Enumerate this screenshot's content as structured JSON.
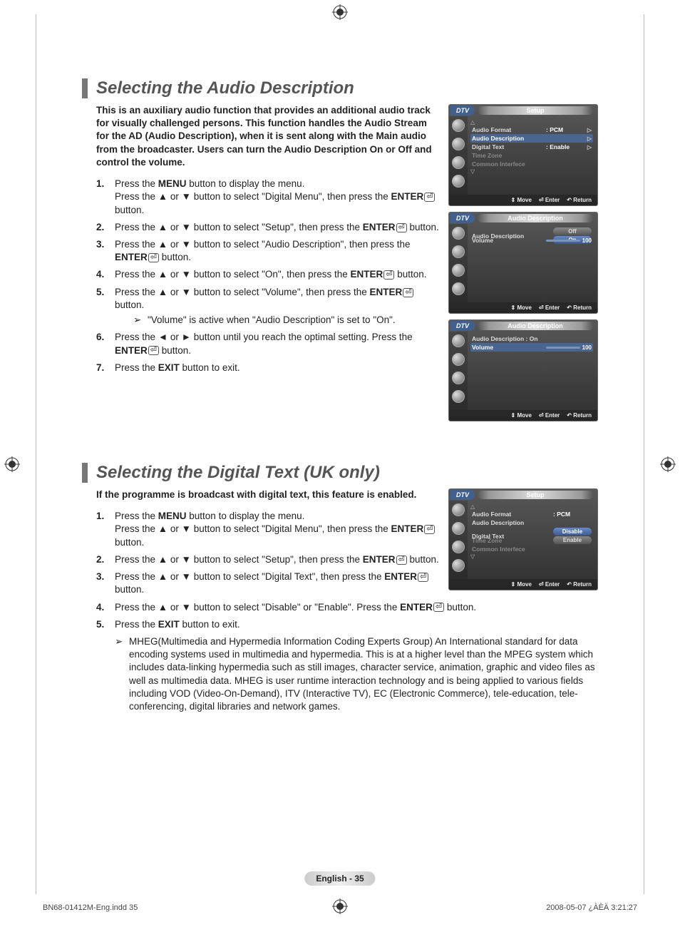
{
  "section1": {
    "title": "Selecting the Audio Description",
    "intro": "This is an auxiliary audio function that provides an additional audio track for visually challenged persons. This function handles the Audio Stream for the AD (Audio Description), when it is sent along with the Main audio from the broadcaster. Users can turn the Audio Description On or Off and control the volume.",
    "steps": [
      {
        "n": "1.",
        "text": "Press the <b>MENU</b> button to display the menu.<br>Press the ▲ or ▼ button to select \"Digital Menu\", then press the <b>ENTER</b><span class='enter-icon'>⏎</span> button."
      },
      {
        "n": "2.",
        "text": "Press the ▲ or ▼ button to select \"Setup\", then press the <b>ENTER</b><span class='enter-icon'>⏎</span> button."
      },
      {
        "n": "3.",
        "text": "Press the ▲ or ▼ button to select \"Audio Description\", then press the <b>ENTER</b><span class='enter-icon'>⏎</span> button."
      },
      {
        "n": "4.",
        "text": "Press the ▲ or ▼ button to select \"On\", then press the <b>ENTER</b><span class='enter-icon'>⏎</span> button."
      },
      {
        "n": "5.",
        "text": "Press the ▲ or ▼ button to select \"Volume\", then press the <b>ENTER</b><span class='enter-icon'>⏎</span> button."
      },
      {
        "n": "6.",
        "text": "Press the ◄ or ► button until you reach the optimal setting. Press the <b>ENTER</b><span class='enter-icon'>⏎</span> button."
      },
      {
        "n": "7.",
        "text": "Press the <b>EXIT</b> button to exit."
      }
    ],
    "note_after_5": "\"Volume\" is active when \"Audio Description\" is set to \"On\"."
  },
  "section2": {
    "title": "Selecting the Digital Text (UK only)",
    "intro": "If the programme is broadcast with digital text, this feature is enabled.",
    "steps": [
      {
        "n": "1.",
        "text": "Press the <b>MENU</b> button to display the menu.<br>Press the ▲ or ▼ button to select \"Digital Menu\", then press the <b>ENTER</b><span class='enter-icon'>⏎</span> button."
      },
      {
        "n": "2.",
        "text": "Press the ▲ or ▼ button to select \"Setup\", then press the <b>ENTER</b><span class='enter-icon'>⏎</span> button."
      },
      {
        "n": "3.",
        "text": "Press the ▲ or ▼ button to select \"Digital Text\", then press the <b>ENTER</b><span class='enter-icon'>⏎</span> button."
      },
      {
        "n": "4.",
        "text": "Press the ▲ or ▼ button to select \"Disable\" or \"Enable\". Press the <b>ENTER</b><span class='enter-icon'>⏎</span> button."
      },
      {
        "n": "5.",
        "text": "Press the <b>EXIT</b> button to exit."
      }
    ],
    "note_after_5": "MHEG(Multimedia and Hypermedia Information Coding Experts Group) An International standard for data encoding systems used in multimedia and hypermedia. This is at a higher level than the MPEG system which includes data-linking hypermedia such as still images, character service, animation, graphic and video files as well as multimedia data. MHEG is user runtime interaction technology and is being applied to various fields including VOD (Video-On-Demand), ITV (Interactive TV), EC (Electronic Commerce), tele-education, tele-conferencing, digital libraries and network games."
  },
  "osd": {
    "dtv": "DTV",
    "setup": "Setup",
    "audio_desc": "Audio Description",
    "move": "Move",
    "enter": "Enter",
    "return": "Return",
    "panel1": {
      "rows": [
        {
          "label": "Audio Format",
          "val": ": PCM"
        },
        {
          "label": "Audio Description",
          "sel": true
        },
        {
          "label": "Digital Text",
          "val": ": Enable"
        },
        {
          "label": "Time Zone",
          "dim": true
        },
        {
          "label": "Common Interfece",
          "dim": true
        }
      ]
    },
    "panel2": {
      "ad_label": "Audio Description",
      "vol_label": "Volume",
      "off": "Off",
      "on": "On",
      "vol": "100"
    },
    "panel3": {
      "ad_label": "Audio Description :",
      "ad_val": "On",
      "vol_label": "Volume",
      "vol": "100"
    },
    "panel4": {
      "rows": [
        {
          "label": "Audio Format",
          "val": ": PCM"
        },
        {
          "label": "Audio Description"
        },
        {
          "label": "Digital Text",
          "opts": [
            "Disable",
            "Enable"
          ],
          "sel": "Disable"
        },
        {
          "label": "Time Zone",
          "dim": true
        },
        {
          "label": "Common Interfece",
          "dim": true
        }
      ]
    }
  },
  "page_number": "English - 35",
  "footer": {
    "left": "BN68-01412M-Eng.indd   35",
    "right": "2008-05-07   ¿ÀÈÄ 3:21:27"
  }
}
